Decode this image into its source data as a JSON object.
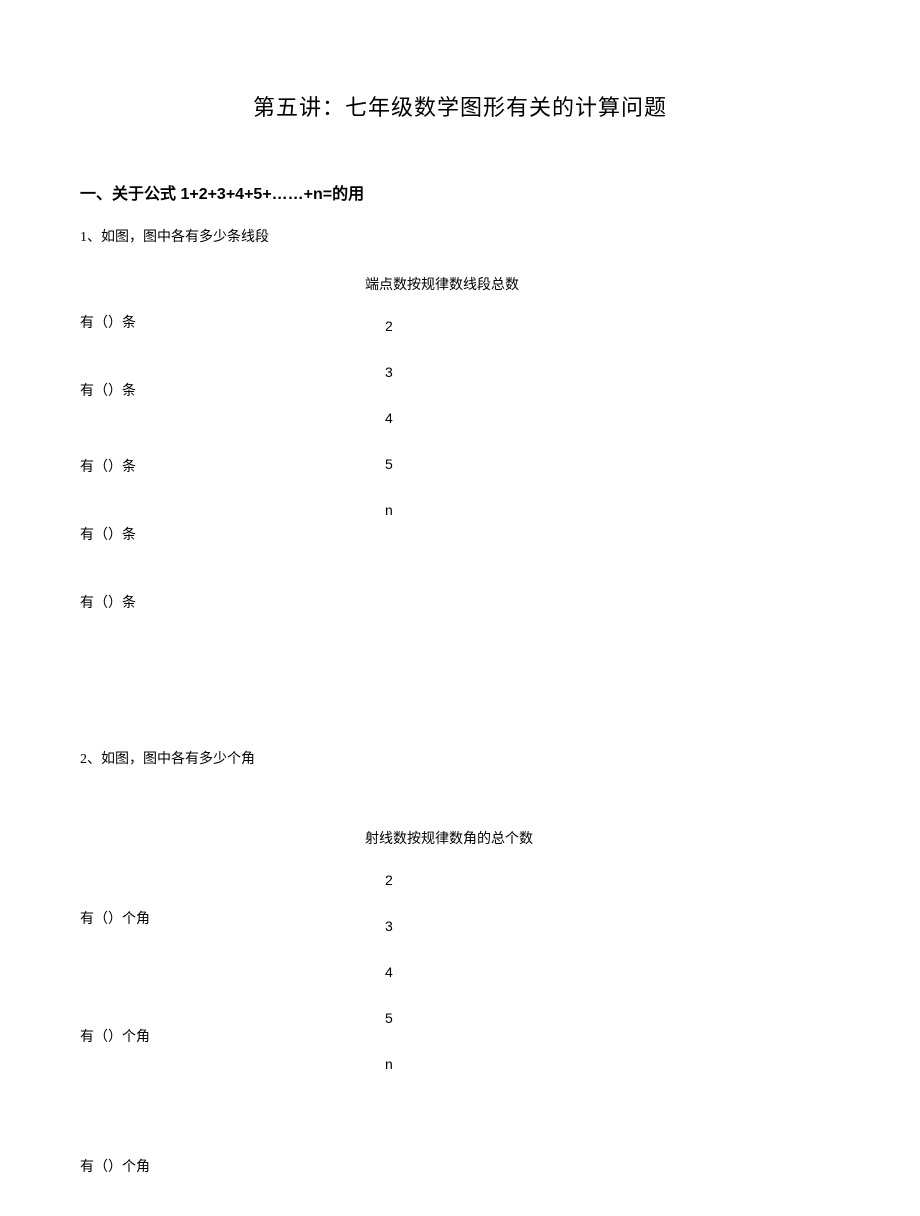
{
  "title": "第五讲：七年级数学图形有关的计算问题",
  "section1": {
    "heading": "一、关于公式 1+2+3+4+5+……+n=的用",
    "q1": {
      "intro": "1、如图，图中各有多少条线段",
      "leftItems": [
        "有（）条",
        "有（）条",
        "有（）条",
        "有（）条",
        "有（）条"
      ],
      "rightHeader": "端点数按规律数线段总数",
      "nums": [
        "2",
        "3",
        "4",
        "5",
        "n"
      ]
    },
    "q2": {
      "intro": "2、如图，图中各有多少个角",
      "leftItems": [
        "有（）个角",
        "有（）个角",
        "有（）个角"
      ],
      "rightHeader": "射线数按规律数角的总个数",
      "nums": [
        "2",
        "3",
        "4",
        "5",
        "n"
      ]
    }
  }
}
